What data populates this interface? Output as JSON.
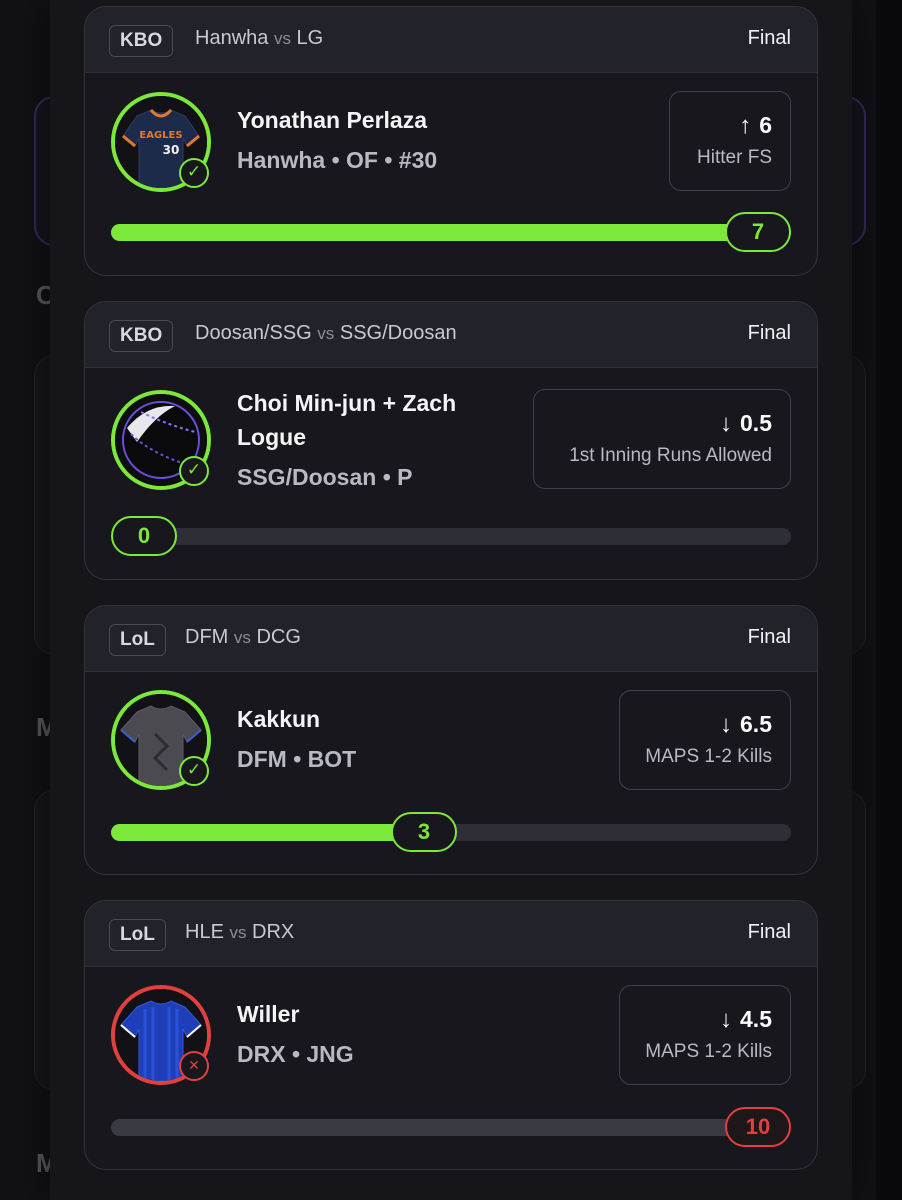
{
  "colors": {
    "win": "#7be83a",
    "loss": "#e2403f"
  },
  "background": {
    "letters": [
      "C",
      "M",
      "M"
    ]
  },
  "picks": [
    {
      "league": "KBO",
      "team_a": "Hanwha",
      "vs": "vs",
      "team_b": "LG",
      "status": "Final",
      "player_name": "Yonathan Perlaza",
      "player_meta": "Hanwha • OF • #30",
      "avatar_icon": "baseball-jersey-icon",
      "jersey_text": "EAGLES",
      "jersey_number": "30",
      "result_icon": "check-icon",
      "result": "win",
      "direction": "up",
      "direction_arrow": "↑",
      "line": "6",
      "stat": "Hitter FS",
      "actual": "7",
      "progress_fraction": 1.0
    },
    {
      "league": "KBO",
      "team_a": "Doosan/SSG",
      "vs": "vs",
      "team_b": "SSG/Doosan",
      "status": "Final",
      "player_name": "Choi Min-jun + Zach Logue",
      "player_meta": "SSG/Doosan • P",
      "avatar_icon": "baseball-icon",
      "result_icon": "check-icon",
      "result": "win",
      "direction": "down",
      "direction_arrow": "↓",
      "line": "0.5",
      "stat": "1st Inning Runs Allowed",
      "actual": "0",
      "progress_fraction": 0.0
    },
    {
      "league": "LoL",
      "team_a": "DFM",
      "vs": "vs",
      "team_b": "DCG",
      "status": "Final",
      "player_name": "Kakkun",
      "player_meta": "DFM • BOT",
      "avatar_icon": "esports-jersey-icon",
      "result_icon": "check-icon",
      "result": "win",
      "direction": "down",
      "direction_arrow": "↓",
      "line": "6.5",
      "stat": "MAPS 1-2 Kills",
      "actual": "3",
      "progress_fraction": 0.46
    },
    {
      "league": "LoL",
      "team_a": "HLE",
      "vs": "vs",
      "team_b": "DRX",
      "status": "Final",
      "player_name": "Willer",
      "player_meta": "DRX • JNG",
      "avatar_icon": "esports-jersey-icon",
      "result_icon": "x-icon",
      "result": "loss",
      "direction": "down",
      "direction_arrow": "↓",
      "line": "4.5",
      "stat": "MAPS 1-2 Kills",
      "actual": "10",
      "progress_fraction": 1.0
    }
  ]
}
